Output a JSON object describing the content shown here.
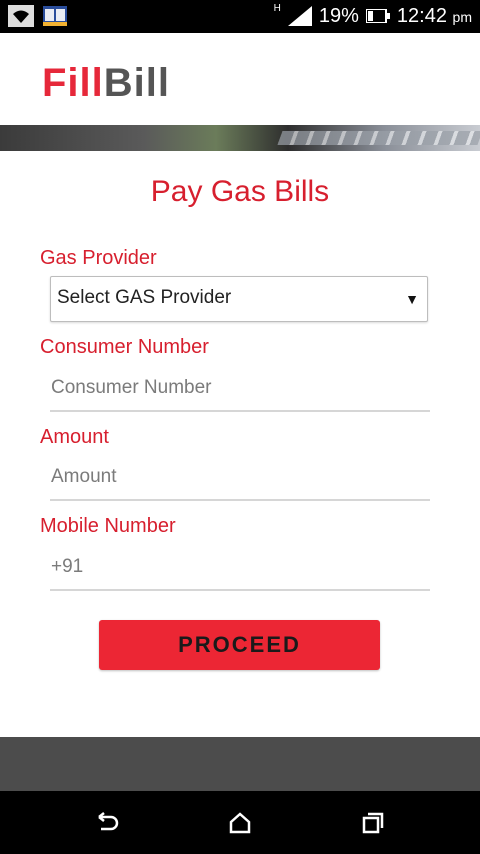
{
  "status_bar": {
    "battery": "19%",
    "time": "12:42",
    "ampm": "pm",
    "network_type": "H",
    "icons": [
      "wifi-icon",
      "book-app-icon",
      "signal-icon",
      "battery-icon"
    ]
  },
  "brand": {
    "logo_part1": "Fill",
    "logo_part2": "Bill",
    "colors": {
      "red": "#e6283a",
      "gray": "#555555"
    }
  },
  "page": {
    "title": "Pay Gas Bills"
  },
  "form": {
    "provider_label": "Gas Provider",
    "provider_selected": "Select GAS Provider",
    "consumer_label": "Consumer Number",
    "consumer_placeholder": "Consumer Number",
    "amount_label": "Amount",
    "amount_placeholder": "Amount",
    "mobile_label": "Mobile Number",
    "mobile_placeholder": "+91",
    "proceed_label": "PROCEED"
  },
  "nav": {
    "icons": [
      "back-icon",
      "home-icon",
      "recent-apps-icon"
    ]
  }
}
